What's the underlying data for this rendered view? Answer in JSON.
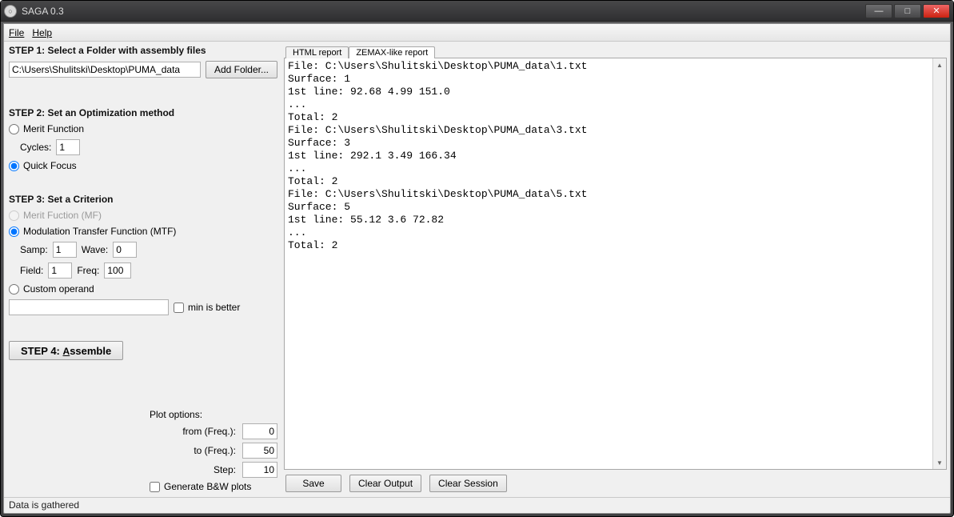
{
  "window_title": "SAGA 0.3",
  "menu": [
    "File",
    "Help"
  ],
  "step1": {
    "title": "STEP 1: Select a Folder with assembly files",
    "path": "C:\\Users\\Shulitski\\Desktop\\PUMA_data",
    "add_btn": "Add Folder..."
  },
  "step2": {
    "title": "STEP 2: Set an Optimization method",
    "merit": "Merit Function",
    "cycles_lbl": "Cycles:",
    "cycles": "1",
    "quick": "Quick Focus"
  },
  "step3": {
    "title": "STEP 3: Set a Criterion",
    "mf": "Merit Fuction (MF)",
    "mtf": "Modulation Transfer Function (MTF)",
    "samp_lbl": "Samp:",
    "samp": "1",
    "wave_lbl": "Wave:",
    "wave": "0",
    "field_lbl": "Field:",
    "field": "1",
    "freq_lbl": "Freq:",
    "freq": "100",
    "custom": "Custom operand",
    "min": "min is better"
  },
  "step4": "STEP 4: Assemble",
  "plot": {
    "title": "Plot options:",
    "from_lbl": "from (Freq.):",
    "from": "0",
    "to_lbl": "to (Freq.):",
    "to": "50",
    "step_lbl": "Step:",
    "step": "10",
    "bw": "Generate B&W plots"
  },
  "tabs": {
    "html": "HTML report",
    "zemax": "ZEMAX-like report"
  },
  "report": "File: C:\\Users\\Shulitski\\Desktop\\PUMA_data\\1.txt\nSurface: 1\n1st line: 92.68 4.99 151.0\n...\nTotal: 2\nFile: C:\\Users\\Shulitski\\Desktop\\PUMA_data\\3.txt\nSurface: 3\n1st line: 292.1 3.49 166.34\n...\nTotal: 2\nFile: C:\\Users\\Shulitski\\Desktop\\PUMA_data\\5.txt\nSurface: 5\n1st line: 55.12 3.6 72.82\n...\nTotal: 2",
  "buttons": {
    "save": "Save",
    "clear_out": "Clear Output",
    "clear_sess": "Clear Session"
  },
  "status": "Data is gathered"
}
